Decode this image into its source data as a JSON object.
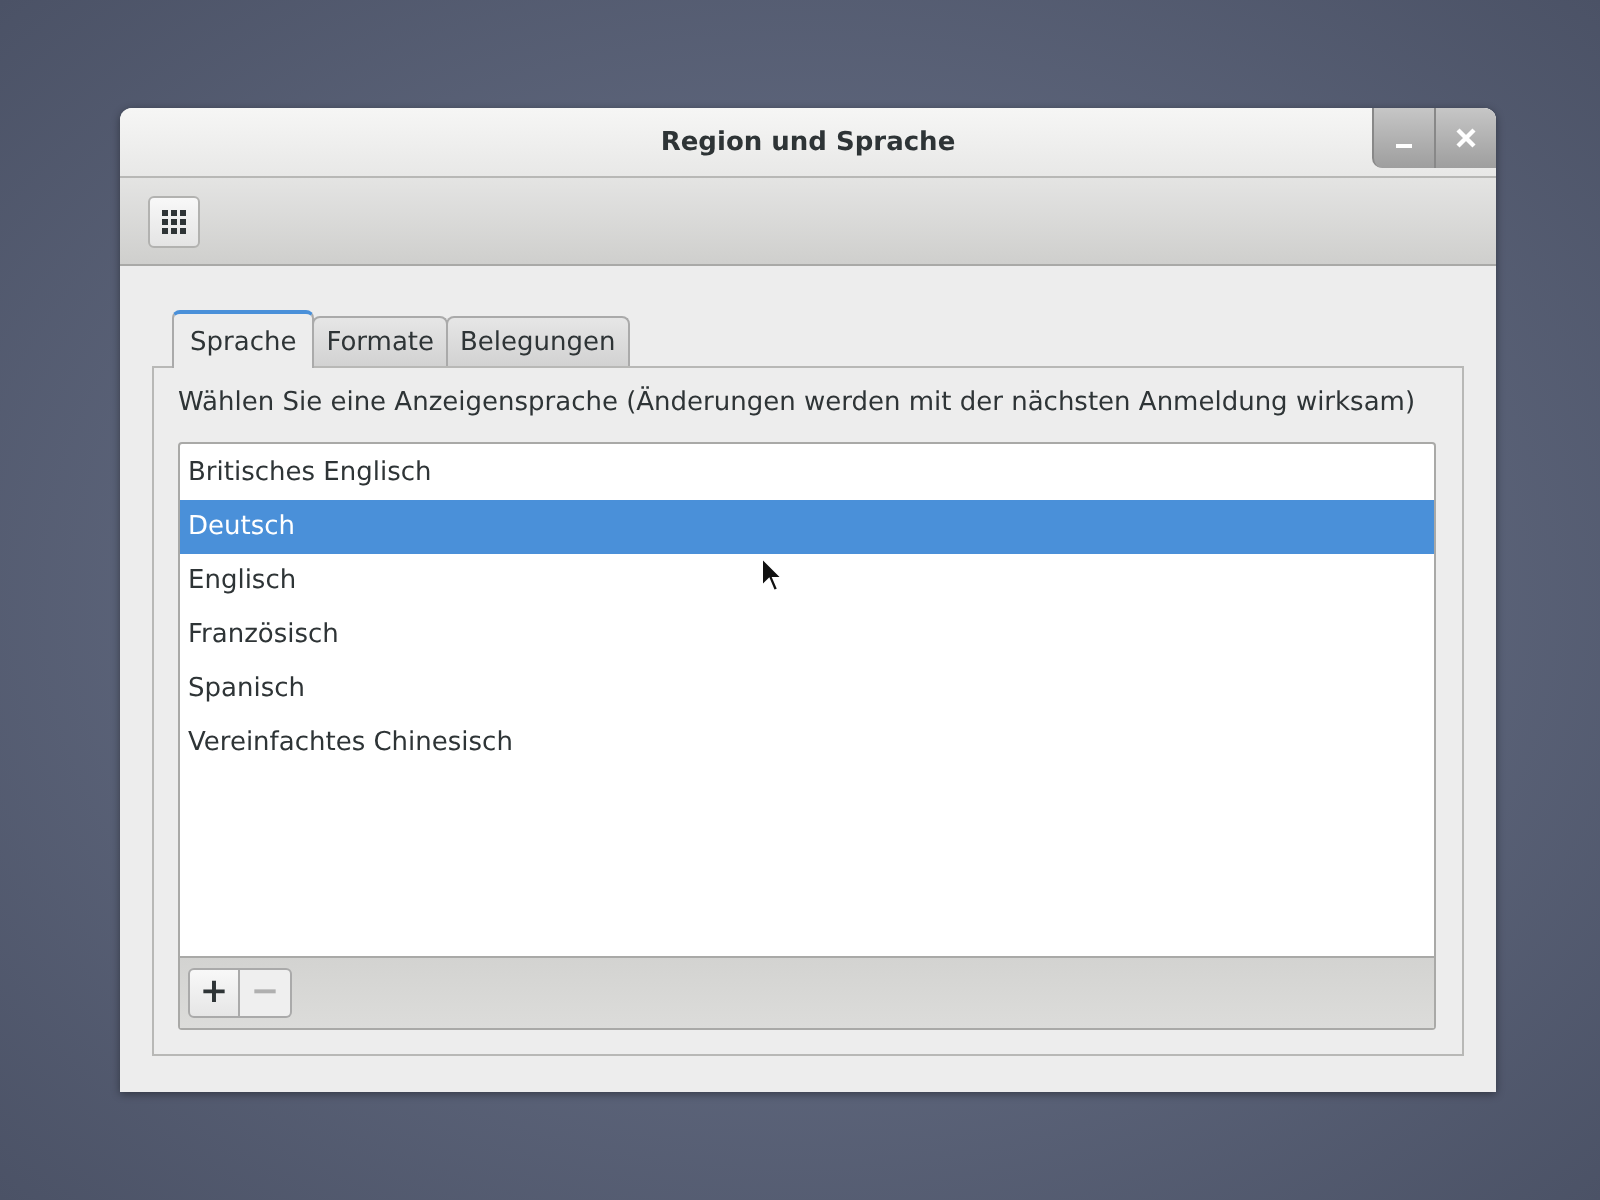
{
  "window": {
    "title": "Region und Sprache"
  },
  "tabs": [
    {
      "label": "Sprache",
      "selected": true
    },
    {
      "label": "Formate",
      "selected": false
    },
    {
      "label": "Belegungen",
      "selected": false
    }
  ],
  "instruction": "Wählen Sie eine Anzeigensprache (Änderungen werden mit der nächsten Anmeldung wirksam)",
  "languages": [
    {
      "label": "Britisches Englisch",
      "selected": false
    },
    {
      "label": "Deutsch",
      "selected": true
    },
    {
      "label": "Englisch",
      "selected": false
    },
    {
      "label": "Französisch",
      "selected": false
    },
    {
      "label": "Spanisch",
      "selected": false
    },
    {
      "label": "Vereinfachtes Chinesisch",
      "selected": false
    }
  ],
  "list_buttons": [
    {
      "label": "+",
      "disabled": false
    },
    {
      "label": "−",
      "disabled": true
    }
  ]
}
